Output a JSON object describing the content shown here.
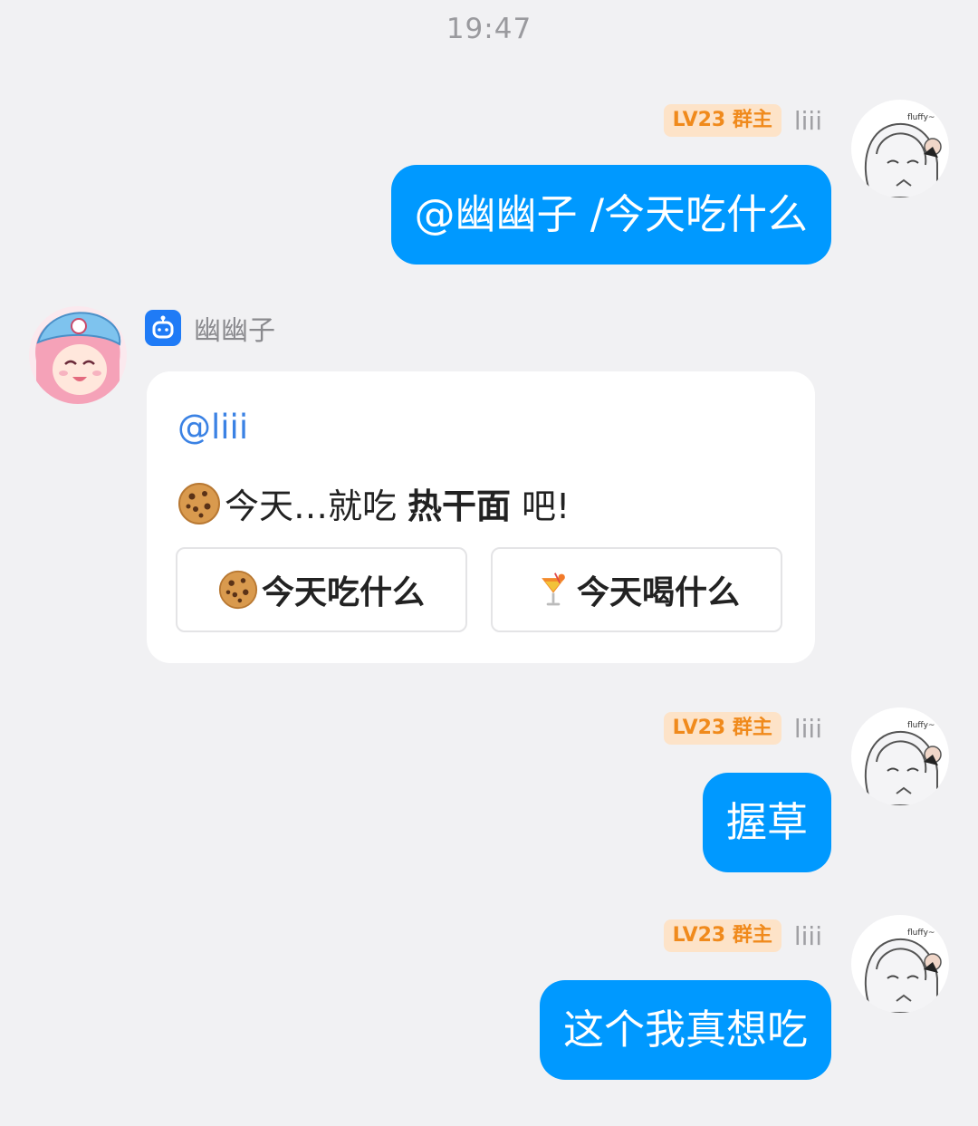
{
  "status": {
    "time": "19:47"
  },
  "messages": [
    {
      "direction": "outgoing",
      "badge": "LV23 群主",
      "sender": "liii",
      "text": "@幽幽子 /今天吃什么"
    },
    {
      "direction": "incoming",
      "sender": "幽幽子",
      "card": {
        "mention": "@liii",
        "emoji": "cookie-icon",
        "prefix": "今天…就吃",
        "highlight": "热干面",
        "suffix": "吧!",
        "buttons": [
          {
            "icon": "cookie-icon",
            "label": "今天吃什么"
          },
          {
            "icon": "cocktail-icon",
            "label": "今天喝什么"
          }
        ]
      }
    },
    {
      "direction": "outgoing",
      "badge": "LV23 群主",
      "sender": "liii",
      "text": "握草"
    },
    {
      "direction": "outgoing",
      "badge": "LV23 群主",
      "sender": "liii",
      "text": "这个我真想吃"
    }
  ],
  "colors": {
    "background": "#f1f1f3",
    "outgoing_bubble": "#0099ff",
    "badge_bg": "#fde3c8",
    "badge_text": "#f08a1c",
    "mention": "#3b82e4",
    "bot_icon": "#1f7bf6"
  }
}
